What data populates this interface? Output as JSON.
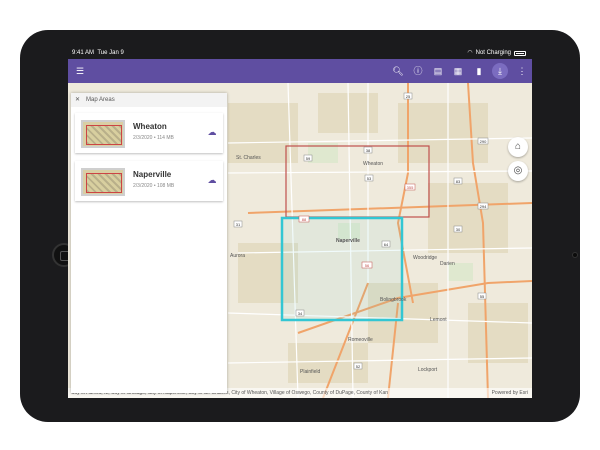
{
  "status_bar": {
    "time": "9:41 AM",
    "date": "Tue Jan 9",
    "battery": "Not Charging"
  },
  "toolbar": {
    "menu_icon": "☰",
    "icons": [
      {
        "name": "search-icon",
        "glyph": "🔍︎"
      },
      {
        "name": "info-icon",
        "glyph": "ⓘ"
      },
      {
        "name": "layers-icon",
        "glyph": "▤"
      },
      {
        "name": "grid-icon",
        "glyph": "▦"
      },
      {
        "name": "bookmark-icon",
        "glyph": "▮"
      },
      {
        "name": "download-icon",
        "glyph": "⤓"
      },
      {
        "name": "more-icon",
        "glyph": "⋮"
      }
    ],
    "accent": "#5f4ea1"
  },
  "panel": {
    "title": "Map Areas",
    "close_icon": "✕",
    "areas": [
      {
        "name": "Wheaton",
        "details": "2/3/2020 • 114 MB",
        "download_icon": "☁"
      },
      {
        "name": "Naperville",
        "details": "2/3/2020 • 108 MB",
        "download_icon": "☁"
      }
    ]
  },
  "map": {
    "labels": {
      "aurora": "Aurora",
      "naperville": "Naperville",
      "wheaton": "Wheaton",
      "woodridge": "Woodridge",
      "darien": "Darien",
      "bolingbrook": "Bolingbrook",
      "lemont": "Lemont",
      "plainfield": "Plainfield",
      "lockport": "Lockport",
      "romeoville": "Romeoville",
      "st_charles": "St. Charles"
    },
    "shields": [
      "59",
      "53",
      "38",
      "88",
      "355",
      "64",
      "56",
      "34",
      "30",
      "55",
      "52",
      "83",
      "294",
      "290",
      "25",
      "31"
    ],
    "area_colors": {
      "wheaton_outline": "#c0504d",
      "naperville_outline": "#33c6d3"
    }
  },
  "buttons": {
    "home_icon": "⌂",
    "locate_icon": "◎"
  },
  "attribution": "City of Aurora, IL, City of Chicago, City of Naperville, City of St. Charles, City of Wheaton, Village of Oswego, County of DuPage, County of Kan",
  "powered_by": "Powered by Esri"
}
